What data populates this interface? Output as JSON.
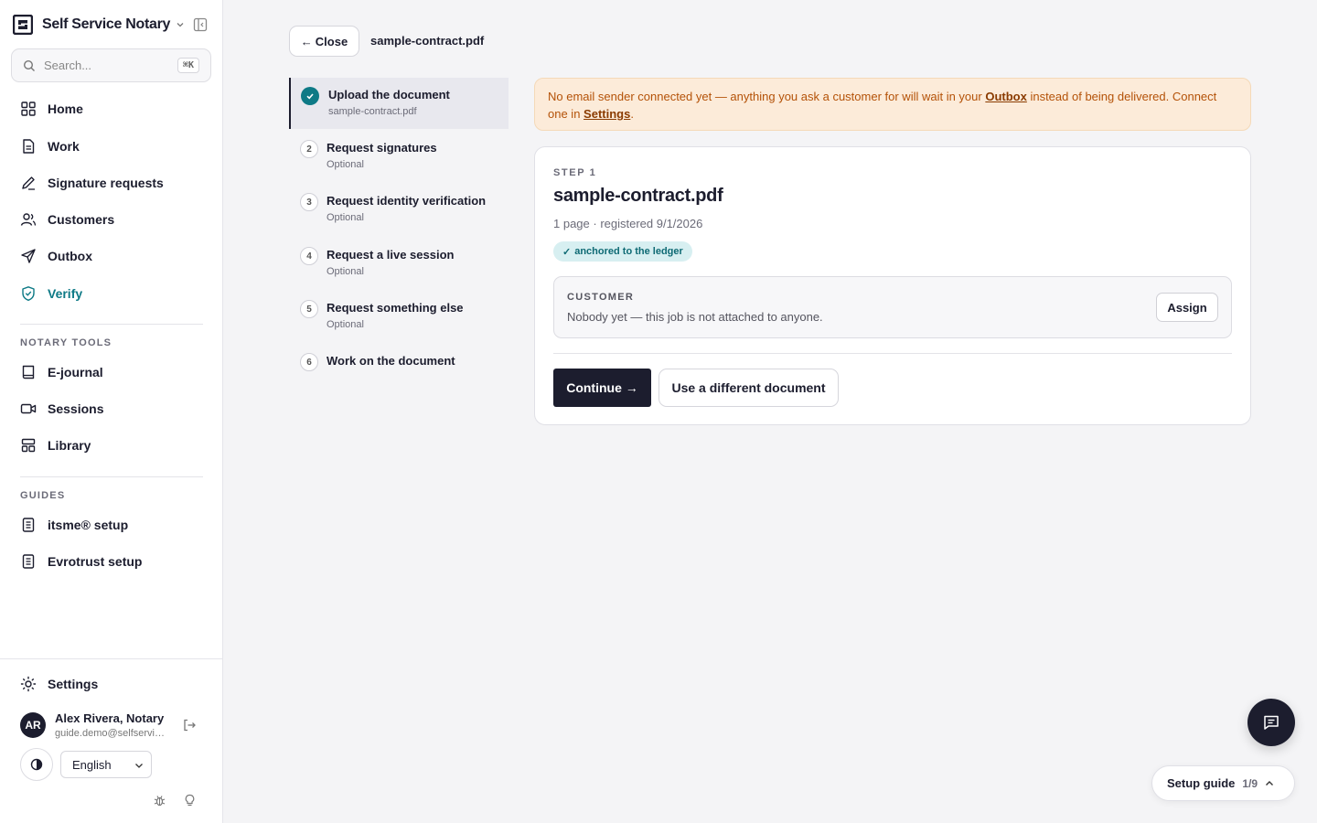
{
  "brand": {
    "name": "Self Service Notary"
  },
  "search": {
    "placeholder": "Search...",
    "shortcut": "⌘K"
  },
  "nav": {
    "items": [
      {
        "label": "Home",
        "icon": "grid-icon"
      },
      {
        "label": "Work",
        "icon": "document-icon"
      },
      {
        "label": "Signature requests",
        "icon": "pen-icon"
      },
      {
        "label": "Customers",
        "icon": "users-icon"
      },
      {
        "label": "Outbox",
        "icon": "send-icon"
      },
      {
        "label": "Verify",
        "icon": "shield-check-icon",
        "active": true
      }
    ],
    "notary_tools_label": "NOTARY TOOLS",
    "notary_tools": [
      {
        "label": "E-journal",
        "icon": "book-icon"
      },
      {
        "label": "Sessions",
        "icon": "video-icon"
      },
      {
        "label": "Library",
        "icon": "library-icon"
      }
    ],
    "guides_label": "GUIDES",
    "guides": [
      {
        "label": "itsme® setup",
        "icon": "guide-book-icon"
      },
      {
        "label": "Evrotrust setup",
        "icon": "guide-book-icon"
      }
    ],
    "settings_label": "Settings"
  },
  "user": {
    "initials": "AR",
    "name": "Alex Rivera, Notary",
    "email": "guide.demo@selfservicenotary.com"
  },
  "language": {
    "selected": "English"
  },
  "header": {
    "close_label": "Close",
    "close_arrow": "←",
    "file_name": "sample-contract.pdf"
  },
  "steps": [
    {
      "title": "Upload the document",
      "sub": "sample-contract.pdf",
      "state": "done"
    },
    {
      "number": "2",
      "title": "Request signatures",
      "sub": "Optional"
    },
    {
      "number": "3",
      "title": "Request identity verification",
      "sub": "Optional"
    },
    {
      "number": "4",
      "title": "Request a live session",
      "sub": "Optional"
    },
    {
      "number": "5",
      "title": "Request something else",
      "sub": "Optional"
    },
    {
      "number": "6",
      "title": "Work on the document",
      "sub": ""
    }
  ],
  "banner": {
    "part1": "No email sender connected yet — anything you ask a customer for will wait in your ",
    "link1": "Outbox",
    "part2": " instead of being delivered. Connect one in ",
    "link2": "Settings",
    "part3": "."
  },
  "card": {
    "step_label": "STEP 1",
    "title": "sample-contract.pdf",
    "meta": "1 page · registered 9/1/2026",
    "badge_check": "✓",
    "badge": "anchored to the ledger",
    "customer_label": "CUSTOMER",
    "customer_value": "Nobody yet — this job is not attached to anyone.",
    "assign_label": "Assign",
    "continue_label": "Continue →",
    "different_doc_label": "Use a different document"
  },
  "setup_guide": {
    "label": "Setup guide",
    "count": "1/9"
  },
  "colors": {
    "accent": "#0e7a86",
    "dark": "#1c1d2e",
    "warning_bg": "#fcebd9",
    "warning_text": "#b45208"
  }
}
